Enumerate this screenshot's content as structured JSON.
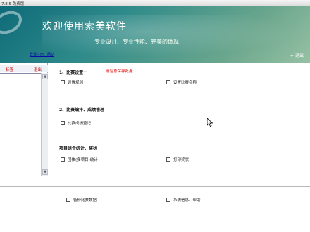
{
  "window": {
    "title": "7.8.5 免费版"
  },
  "banner": {
    "title": "欢迎使用索美软件",
    "slogan": "专业设计、专业性能、完美的体现!",
    "login_link": "登录注册、网站",
    "help": "退出"
  },
  "left_panel": {
    "header_left": "标签",
    "header_right": "退出"
  },
  "sections": [
    {
      "title": "1、比赛设置一",
      "hint": "请注意保存数据"
    },
    {
      "title": "2、比赛编排、成绩管理"
    },
    {
      "title": "项目组合统计、奖状"
    }
  ],
  "checkboxes": [
    {
      "label": "设置规则"
    },
    {
      "label": "设置比赛名称"
    },
    {
      "label": "比赛成绩登记"
    },
    {
      "label": "团体(多项目)统计"
    },
    {
      "label": "打印奖状"
    },
    {
      "label": "备份比赛数据"
    },
    {
      "label": "系统信息、帮助"
    }
  ]
}
